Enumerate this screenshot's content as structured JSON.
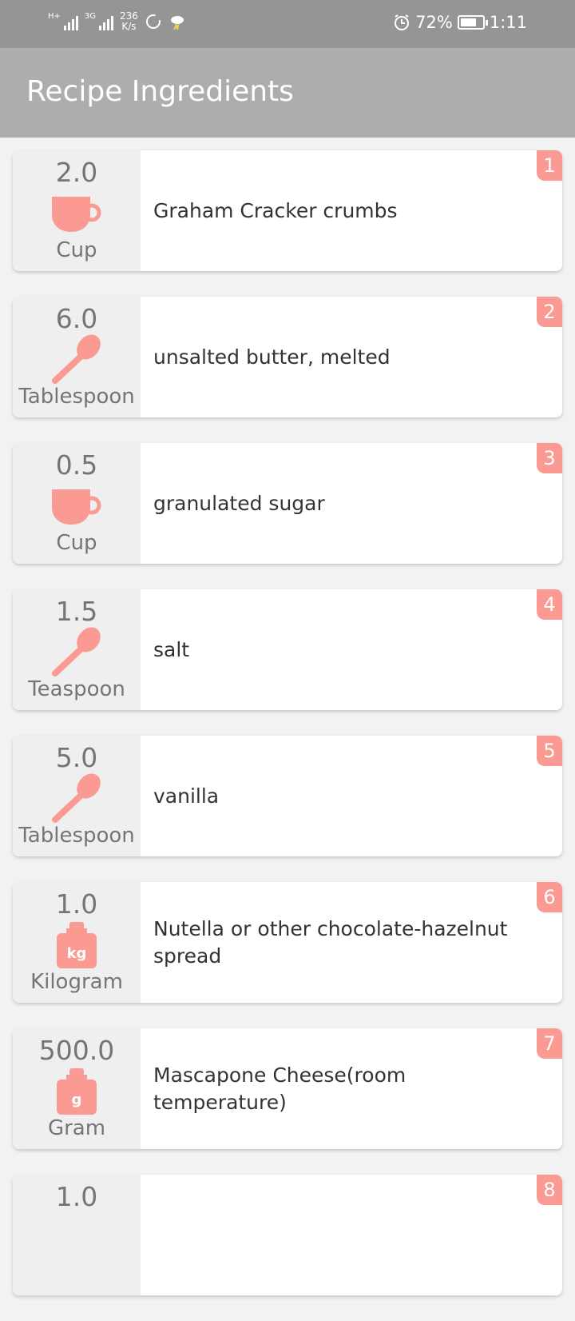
{
  "status_bar": {
    "network_1": "H+",
    "network_2": "3G",
    "speed_value": "236",
    "speed_unit": "K/s",
    "battery_percent": "72%",
    "battery_level": 0.72,
    "time": "1:11"
  },
  "app_bar": {
    "title": "Recipe Ingredients"
  },
  "colors": {
    "accent": "#fa9a92",
    "app_bar": "#adadad",
    "status_bar": "#959595"
  },
  "ingredients": [
    {
      "index": "1",
      "qty": "2.0",
      "unit": "Cup",
      "icon": "cup-icon",
      "name": "Graham Cracker crumbs"
    },
    {
      "index": "2",
      "qty": "6.0",
      "unit": "Tablespoon",
      "icon": "spoon-icon",
      "name": "unsalted butter, melted"
    },
    {
      "index": "3",
      "qty": "0.5",
      "unit": "Cup",
      "icon": "cup-icon",
      "name": "granulated sugar"
    },
    {
      "index": "4",
      "qty": "1.5",
      "unit": "Teaspoon",
      "icon": "spoon-icon",
      "name": "salt"
    },
    {
      "index": "5",
      "qty": "5.0",
      "unit": "Tablespoon",
      "icon": "spoon-icon",
      "name": "vanilla"
    },
    {
      "index": "6",
      "qty": "1.0",
      "unit": "Kilogram",
      "icon": "weight-icon",
      "weight_label": "kg",
      "name": "Nutella or other chocolate-hazelnut spread"
    },
    {
      "index": "7",
      "qty": "500.0",
      "unit": "Gram",
      "icon": "weight-icon",
      "weight_label": "g",
      "name": "Mascapone Cheese(room temperature)"
    },
    {
      "index": "8",
      "qty": "1.0",
      "unit": "",
      "icon": "",
      "name": ""
    }
  ]
}
